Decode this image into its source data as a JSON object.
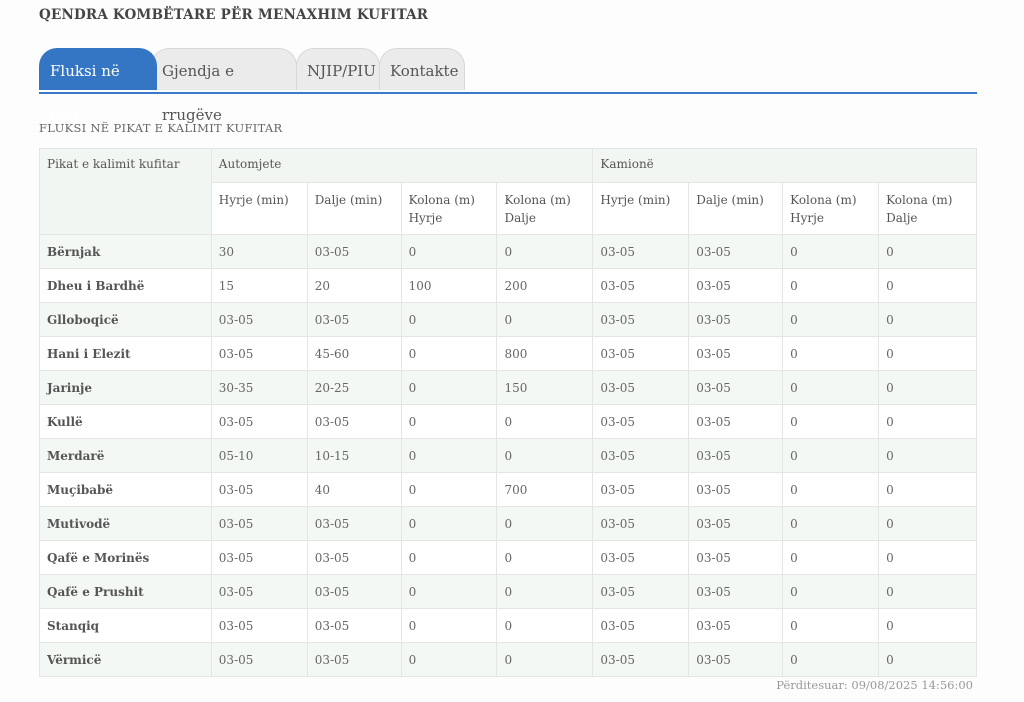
{
  "header": {
    "title": "QENDRA KOMBËTARE PËR MENAXHIM KUFITAR"
  },
  "tabs": [
    {
      "label": "Fluksi në kufi",
      "active": true
    },
    {
      "label": "Gjendja e rrugëve",
      "active": false
    },
    {
      "label": "NJIP/PIU",
      "active": false
    },
    {
      "label": "Kontakte",
      "active": false
    }
  ],
  "section": {
    "title": "FLUKSI NË PIKAT E KALIMIT KUFITAR"
  },
  "table": {
    "row_header": "Pikat e kalimit kufitar",
    "groups": [
      "Automjete",
      "Kamionë"
    ],
    "sub_headers": [
      "Hyrje (min)",
      "Dalje (min)",
      "Kolona (m) Hyrje",
      "Kolona (m) Dalje",
      "Hyrje (min)",
      "Dalje (min)",
      "Kolona (m) Hyrje",
      "Kolona (m) Dalje"
    ],
    "rows": [
      {
        "name": "Bërnjak",
        "values": [
          "30",
          "03-05",
          "0",
          "0",
          "03-05",
          "03-05",
          "0",
          "0"
        ]
      },
      {
        "name": "Dheu i Bardhë",
        "values": [
          "15",
          "20",
          "100",
          "200",
          "03-05",
          "03-05",
          "0",
          "0"
        ]
      },
      {
        "name": "Glloboqicë",
        "values": [
          "03-05",
          "03-05",
          "0",
          "0",
          "03-05",
          "03-05",
          "0",
          "0"
        ]
      },
      {
        "name": "Hani i Elezit",
        "values": [
          "03-05",
          "45-60",
          "0",
          "800",
          "03-05",
          "03-05",
          "0",
          "0"
        ]
      },
      {
        "name": "Jarinje",
        "values": [
          "30-35",
          "20-25",
          "0",
          "150",
          "03-05",
          "03-05",
          "0",
          "0"
        ]
      },
      {
        "name": "Kullë",
        "values": [
          "03-05",
          "03-05",
          "0",
          "0",
          "03-05",
          "03-05",
          "0",
          "0"
        ]
      },
      {
        "name": "Merdarë",
        "values": [
          "05-10",
          "10-15",
          "0",
          "0",
          "03-05",
          "03-05",
          "0",
          "0"
        ]
      },
      {
        "name": "Muçibabë",
        "values": [
          "03-05",
          "40",
          "0",
          "700",
          "03-05",
          "03-05",
          "0",
          "0"
        ]
      },
      {
        "name": "Mutivodë",
        "values": [
          "03-05",
          "03-05",
          "0",
          "0",
          "03-05",
          "03-05",
          "0",
          "0"
        ]
      },
      {
        "name": "Qafë e Morinës",
        "values": [
          "03-05",
          "03-05",
          "0",
          "0",
          "03-05",
          "03-05",
          "0",
          "0"
        ]
      },
      {
        "name": "Qafë e Prushit",
        "values": [
          "03-05",
          "03-05",
          "0",
          "0",
          "03-05",
          "03-05",
          "0",
          "0"
        ]
      },
      {
        "name": "Stanqiq",
        "values": [
          "03-05",
          "03-05",
          "0",
          "0",
          "03-05",
          "03-05",
          "0",
          "0"
        ]
      },
      {
        "name": "Vërmicë",
        "values": [
          "03-05",
          "03-05",
          "0",
          "0",
          "03-05",
          "03-05",
          "0",
          "0"
        ]
      }
    ]
  },
  "footer": {
    "updated": "Përditesuar: 09/08/2025 14:56:00"
  },
  "colors": {
    "accent": "#3576c4",
    "tab_inactive": "#ebebeb",
    "row_alt": "#f4f8f4"
  }
}
